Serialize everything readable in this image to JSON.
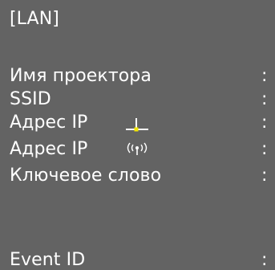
{
  "screen": {
    "title": "[LAN]",
    "rows": [
      {
        "label": "Имя проектора",
        "colon": ":"
      },
      {
        "label": "SSID",
        "colon": ":"
      },
      {
        "label": "Адрес IP",
        "colon": ":",
        "icon": "wired-lan-icon"
      },
      {
        "label": "Адрес IP",
        "colon": ":",
        "icon": "wireless-lan-icon"
      },
      {
        "label": "Ключевое слово",
        "colon": ":"
      },
      {
        "label": "Event ID",
        "colon": ":"
      }
    ]
  },
  "colors": {
    "background": "#636363",
    "text": "#ffffff",
    "wired_icon_dot": "#f2e600"
  }
}
